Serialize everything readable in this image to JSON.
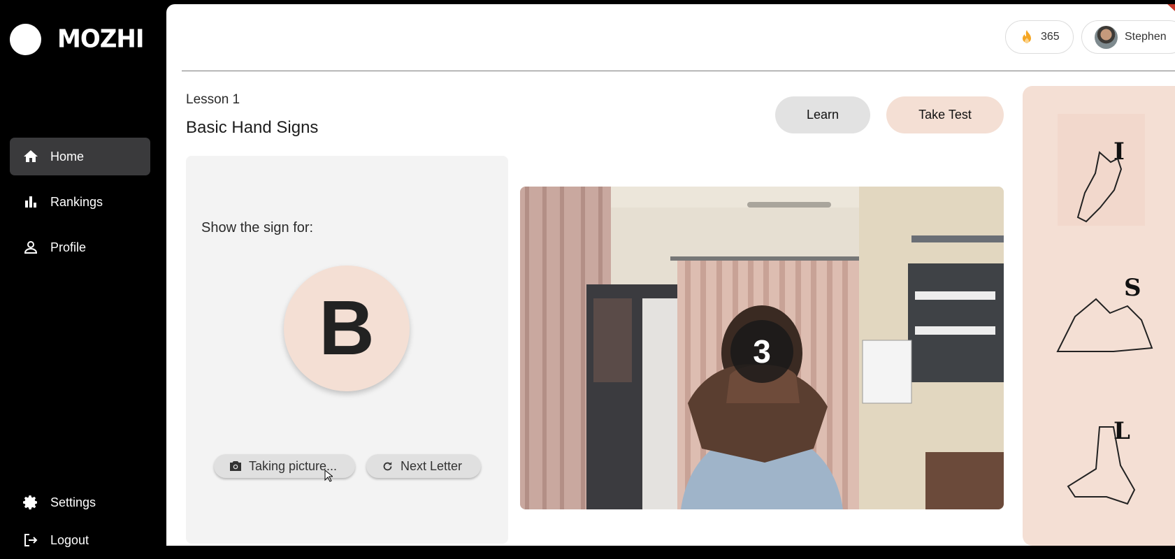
{
  "app": {
    "name": "MOZHI"
  },
  "sidebar": {
    "items": [
      {
        "label": "Home",
        "icon": "home-icon",
        "active": true
      },
      {
        "label": "Rankings",
        "icon": "bar-chart-icon"
      },
      {
        "label": "Profile",
        "icon": "person-icon"
      }
    ],
    "bottom_items": [
      {
        "label": "Settings",
        "icon": "gear-icon"
      },
      {
        "label": "Logout",
        "icon": "logout-icon"
      }
    ]
  },
  "header": {
    "streak": {
      "count": "365",
      "icon": "flame-icon",
      "color": "#f5a623"
    },
    "user": {
      "name": "Stephen"
    }
  },
  "lesson": {
    "number": "Lesson 1",
    "title": "Basic Hand Signs"
  },
  "actions": {
    "learn_label": "Learn",
    "test_label": "Take Test"
  },
  "practice": {
    "prompt": "Show the sign for:",
    "target_letter": "B",
    "take_picture_label": "Taking picture...",
    "next_letter_label": "Next Letter"
  },
  "camera": {
    "countdown": "3"
  },
  "reference_signs": [
    {
      "letter": "I"
    },
    {
      "letter": "S"
    },
    {
      "letter": "L"
    }
  ],
  "colors": {
    "accent_peach": "#f4dfd4",
    "sidebar_bg": "#000000",
    "active_item_bg": "#3a3a3c"
  }
}
